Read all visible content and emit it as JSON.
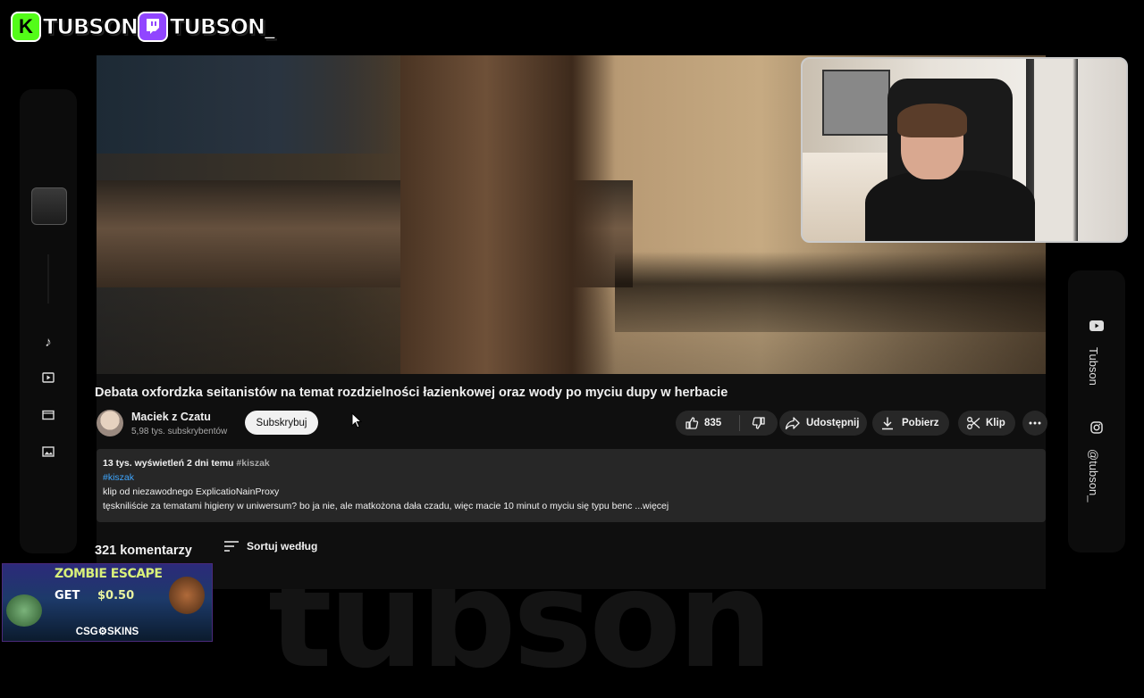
{
  "overlay": {
    "kick_name": "TUBSON",
    "twitch_name": "TUBSON_",
    "watermark": "tubson",
    "right_sidebar": {
      "youtube_label": "Tubson",
      "instagram_label": "@tubson_"
    },
    "ad": {
      "headline": "ZOMBIE ESCAPE",
      "get_label": "GET",
      "amount": "$0.50",
      "brand": "CSG⚙SKINS"
    }
  },
  "video": {
    "title": "Debata oxfordzka seitanistów na temat rozdzielności łazienkowej oraz wody po myciu dupy w herbacie",
    "channel_name": "Maciek z Czatu",
    "subscribers": "5,98 tys. subskrybentów",
    "subscribe_label": "Subskrybuj",
    "like_count": "835",
    "share_label": "Udostępnij",
    "download_label": "Pobierz",
    "clip_label": "Klip"
  },
  "description": {
    "meta": "13 tys. wyświetleń  2 dni temu",
    "meta_tag": "#kiszak",
    "hashtag": "#kiszak",
    "line1": "klip od niezawodnego ExplicatioNainProxy",
    "line2": "tęskniliście za tematami higieny w uniwersum? bo ja nie, ale matkożona dała czadu, więc macie 10 minut o myciu się typu benc ...więcej"
  },
  "comments": {
    "count_label": "321 komentarzy",
    "sort_label": "Sortuj według"
  },
  "colors": {
    "bg": "#0f0f0f",
    "panel": "#272727",
    "link": "#3ea6ff",
    "kick": "#53fc18",
    "twitch": "#9146ff"
  }
}
